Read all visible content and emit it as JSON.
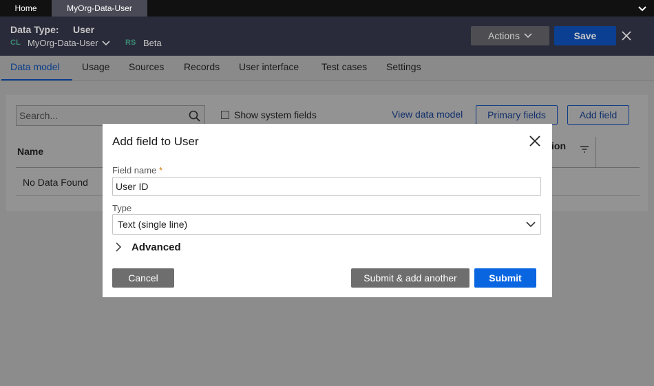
{
  "tabs": {
    "home": "Home",
    "active": "MyOrg-Data-User"
  },
  "header": {
    "type_label": "Data Type:",
    "type_value": "User",
    "cl_badge": "CL",
    "class_name": "MyOrg-Data-User",
    "rs_badge": "RS",
    "ruleset": "Beta",
    "actions_label": "Actions",
    "save_label": "Save"
  },
  "nav": {
    "items": [
      "Data model",
      "Usage",
      "Sources",
      "Records",
      "User interface",
      "Test cases",
      "Settings"
    ],
    "active_index": 0
  },
  "toolbar": {
    "search_placeholder": "Search...",
    "show_system_fields": "Show system fields",
    "show_system_fields_checked": false,
    "view_data_model": "View data model",
    "primary_fields": "Primary fields",
    "add_field": "Add field"
  },
  "table": {
    "column_name": "Name",
    "column_partial": "ion",
    "empty_text": "No Data Found"
  },
  "modal": {
    "title": "Add field to User",
    "field_name_label": "Field name",
    "field_name_required": "*",
    "field_name_value": "User ID",
    "type_label": "Type",
    "type_value": "Text (single line)",
    "advanced_label": "Advanced",
    "cancel_label": "Cancel",
    "submit_another_label": "Submit & add another",
    "submit_label": "Submit"
  },
  "colors": {
    "primary": "#0a66e0",
    "header_bg": "#2a2b3a",
    "required": "#d07a00"
  }
}
